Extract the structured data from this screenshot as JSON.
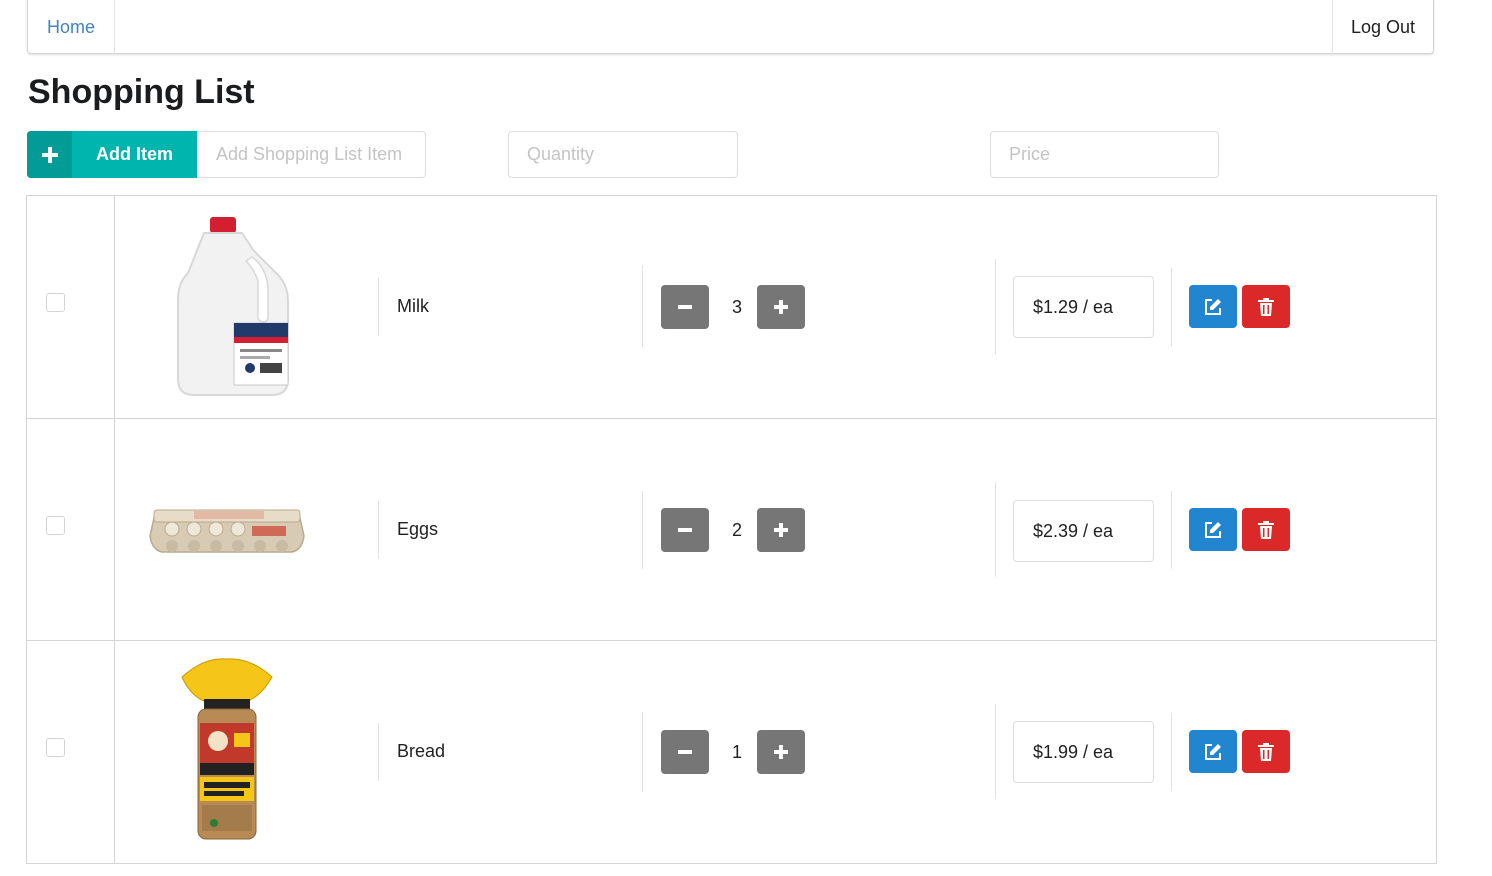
{
  "nav": {
    "home_label": "Home",
    "logout_label": "Log Out"
  },
  "page": {
    "title": "Shopping List"
  },
  "add_bar": {
    "button_label": "Add Item",
    "name_placeholder": "Add Shopping List Item Here",
    "quantity_placeholder": "Quantity",
    "price_placeholder": "Price"
  },
  "items": [
    {
      "name": "Milk",
      "quantity": "3",
      "price": "$1.29 / ea",
      "checked": false,
      "image": "milk-jug-image"
    },
    {
      "name": "Eggs",
      "quantity": "2",
      "price": "$2.39 / ea",
      "checked": false,
      "image": "egg-carton-image"
    },
    {
      "name": "Bread",
      "quantity": "1",
      "price": "$1.99 / ea",
      "checked": false,
      "image": "bread-loaf-image"
    }
  ],
  "icons": {
    "add": "plus-icon",
    "decrement": "minus-icon",
    "increment": "plus-icon",
    "edit": "edit-icon",
    "delete": "trash-icon"
  },
  "colors": {
    "teal": "#00b5ad",
    "blue": "#2185d0",
    "red": "#db2828",
    "grey": "#767676",
    "link": "#4183c4"
  }
}
